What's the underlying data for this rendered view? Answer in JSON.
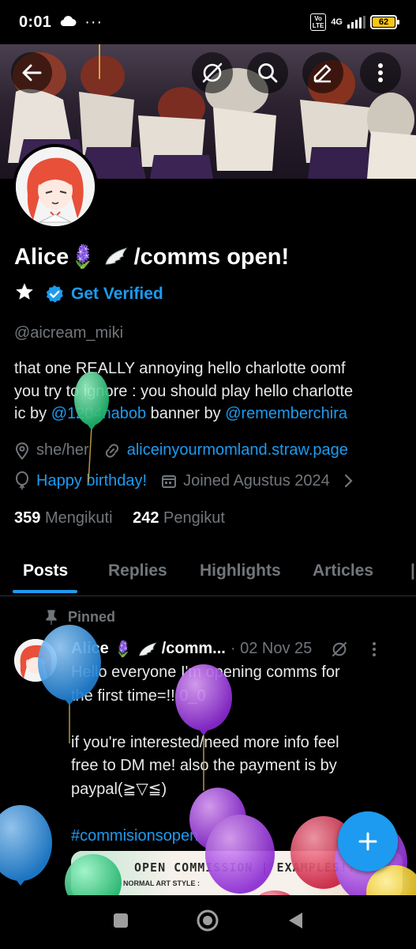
{
  "status_bar": {
    "time": "0:01",
    "network": "4G",
    "volte": "Vo LTE",
    "battery": "62"
  },
  "header": {
    "icons": [
      "back-arrow-icon",
      "grok-icon",
      "search-icon",
      "edit-icon",
      "more-icon"
    ]
  },
  "profile": {
    "name": "Alice",
    "name_emoji": "🪻",
    "name_suffix": "/comms open!",
    "get_verified": "Get Verified",
    "handle": "@aicream_miki",
    "bio_line1": "that one REALLY annoying hello charlotte oomf",
    "bio_line2": "you try to ignore : you should play hello charlotte",
    "bio_line3_pre": "ic by ",
    "bio_mention1": "@1204nabob",
    "bio_line3_mid": " banner by ",
    "bio_mention2": "@rememberchira",
    "pronouns": "she/her",
    "website": "aliceinyourmomland.straw.page",
    "birthday": "Happy birthday!",
    "joined": "Joined Agustus 2024",
    "following_count": "359",
    "following_label": "Mengikuti",
    "followers_count": "242",
    "followers_label": "Pengikut"
  },
  "tabs": [
    {
      "label": "Posts",
      "active": true
    },
    {
      "label": "Replies",
      "active": false
    },
    {
      "label": "Highlights",
      "active": false
    },
    {
      "label": "Articles",
      "active": false
    }
  ],
  "pinned_post": {
    "pinned_label": "Pinned",
    "author": "Alice",
    "author_emoji": "🪻",
    "author_suffix": "/comm...",
    "date": "· 02 Nov 25",
    "line1": "Hello everyone I'm opening comms for",
    "line2": "the first time=!! 0_0",
    "line3": "if you're interested/need more info feel",
    "line4": "free to DM me! also the payment is by",
    "line5": "paypal(≧▽≦)",
    "hashtag": "#commisionsopen",
    "media_title": "OPEN COMMISSION | EXAMPLES!! :",
    "media_subtitle": "NORMAL ART STYLE :"
  },
  "colors": {
    "accent": "#1d9bf0",
    "background": "#000000",
    "muted": "#71767b"
  }
}
